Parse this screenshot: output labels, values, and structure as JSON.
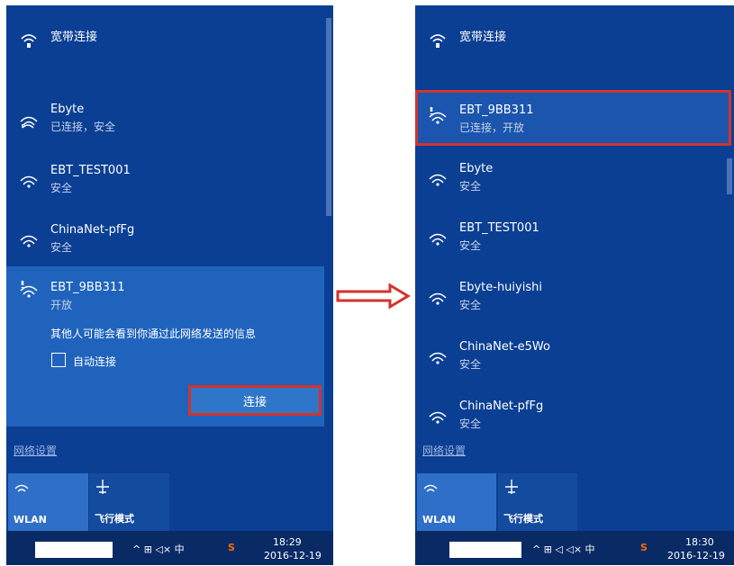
{
  "colors": {
    "panel": "#0b3f93",
    "expanded": "#1f63bd",
    "highlight_border": "#d3332c",
    "tile_active": "#2f6fc7"
  },
  "left": {
    "broadband_label": "宽带连接",
    "networks": [
      {
        "name": "Ebyte",
        "status": "已连接，安全",
        "icon": "wifi-icon"
      },
      {
        "name": "EBT_TEST001",
        "status": "安全",
        "icon": "wifi-icon"
      },
      {
        "name": "ChinaNet-pfFg",
        "status": "安全",
        "icon": "wifi-icon"
      }
    ],
    "expanded_network": {
      "name": "EBT_9BB311",
      "status": "开放",
      "warning": "其他人可能会看到你通过此网络发送的信息",
      "auto_connect_label": "自动连接",
      "auto_connect_checked": false,
      "connect_label": "连接"
    },
    "settings_link": "网络设置",
    "tiles": {
      "wlan": "WLAN",
      "airplane": "飞行模式"
    },
    "tray": {
      "icons": "^ ⊞ ◁× 中",
      "time": "18:29",
      "date": "2016-12-19"
    }
  },
  "right": {
    "broadband_label": "宽带连接",
    "networks": [
      {
        "name": "EBT_9BB311",
        "status": "已连接，开放",
        "icon": "wifi-warning-icon",
        "highlighted": true
      },
      {
        "name": "Ebyte",
        "status": "安全",
        "icon": "wifi-icon"
      },
      {
        "name": "EBT_TEST001",
        "status": "安全",
        "icon": "wifi-icon"
      },
      {
        "name": "Ebyte-huiyishi",
        "status": "安全",
        "icon": "wifi-icon"
      },
      {
        "name": "ChinaNet-e5Wo",
        "status": "安全",
        "icon": "wifi-icon"
      },
      {
        "name": "ChinaNet-pfFg",
        "status": "安全",
        "icon": "wifi-icon"
      }
    ],
    "settings_link": "网络设置",
    "tiles": {
      "wlan": "WLAN",
      "airplane": "飞行模式"
    },
    "tray": {
      "icons": "^ ⊞ ◁ ◁× 中",
      "time": "18:30",
      "date": "2016-12-19"
    }
  }
}
